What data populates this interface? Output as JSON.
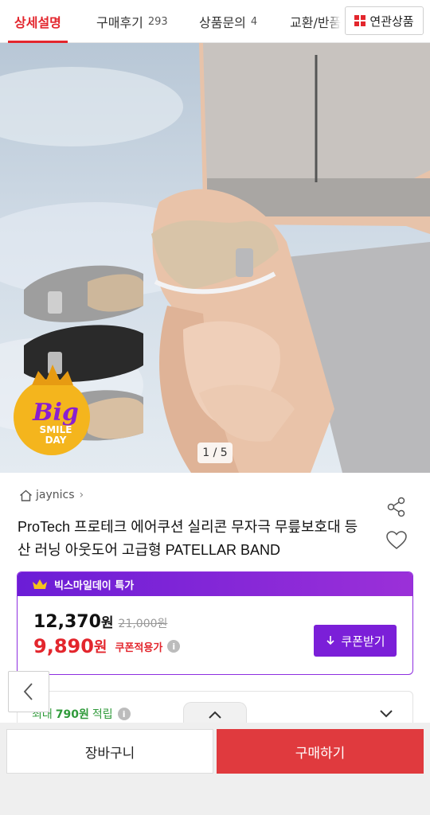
{
  "tabs": [
    {
      "label": "상세설명",
      "count": ""
    },
    {
      "label": "구매후기",
      "count": "293"
    },
    {
      "label": "상품문의",
      "count": "4"
    },
    {
      "label": "교환/반품",
      "count": ""
    }
  ],
  "related_button": {
    "label": "연관상품",
    "icon": "grid-icon"
  },
  "hero": {
    "counter": "1 / 5",
    "badge_big": "Big",
    "badge_line1": "SMILE",
    "badge_line2": "DAY"
  },
  "seller": {
    "name": "jaynics",
    "icon": "home-icon"
  },
  "product": {
    "title": "ProTech 프로테크 에어쿠션 실리콘 무자극 무릎보호대 등산 러닝 아웃도어 고급형 PATELLAR BAND"
  },
  "price_box": {
    "header": "빅스마일데이 특가",
    "price": "12,370",
    "price_unit": "원",
    "original_price": "21,000원",
    "coupon_price": "9,890",
    "coupon_unit": "원",
    "coupon_label": "쿠폰적용가",
    "coupon_button": "쿠폰받기"
  },
  "points": {
    "prefix": "최대",
    "amount": "790원",
    "suffix": "적립"
  },
  "bottom": {
    "cart": "장바구니",
    "buy": "구매하기"
  },
  "colors": {
    "accent": "#e3262d",
    "promo": "#7b1fd8",
    "points": "#2f9a3a"
  }
}
